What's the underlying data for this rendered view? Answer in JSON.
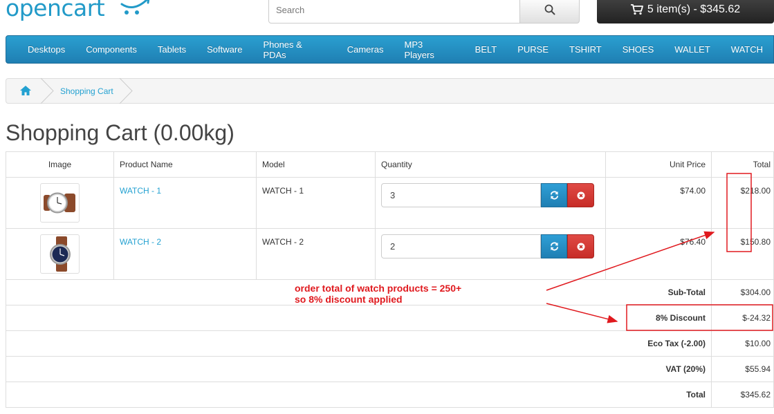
{
  "header": {
    "logo_text": "opencart",
    "search_placeholder": "Search",
    "cart_label": "5 item(s) - $345.62"
  },
  "menu": [
    "Desktops",
    "Components",
    "Tablets",
    "Software",
    "Phones & PDAs",
    "Cameras",
    "MP3 Players",
    "BELT",
    "PURSE",
    "TSHIRT",
    "SHOES",
    "WALLET",
    "WATCH"
  ],
  "breadcrumb": {
    "current": "Shopping Cart"
  },
  "page_title": "Shopping Cart (0.00kg)",
  "table": {
    "headers": {
      "image": "Image",
      "name": "Product Name",
      "model": "Model",
      "quantity": "Quantity",
      "unit_price": "Unit Price",
      "total": "Total"
    },
    "rows": [
      {
        "name": "WATCH - 1",
        "model": "WATCH - 1",
        "quantity": "3",
        "unit_price": "$74.00",
        "total": "$218.00",
        "watch_dial": "white"
      },
      {
        "name": "WATCH - 2",
        "model": "WATCH - 2",
        "quantity": "2",
        "unit_price": "$76.40",
        "total": "$150.80",
        "watch_dial": "navy"
      }
    ],
    "totals": [
      {
        "label": "Sub-Total",
        "value": "$304.00"
      },
      {
        "label": "8% Discount",
        "value": "$-24.32"
      },
      {
        "label": "Eco Tax (-2.00)",
        "value": "$10.00"
      },
      {
        "label": "VAT (20%)",
        "value": "$55.94"
      },
      {
        "label": "Total",
        "value": "$345.62"
      }
    ]
  },
  "annotation": {
    "line1": "order total of watch products = 250+",
    "line2": "so 8% discount applied",
    "color": "#e0191e"
  },
  "colors": {
    "brand": "#229ac8",
    "link": "#23a1d1",
    "menu": "#229ac8",
    "update": "#229ac8",
    "remove": "#d9534f"
  }
}
